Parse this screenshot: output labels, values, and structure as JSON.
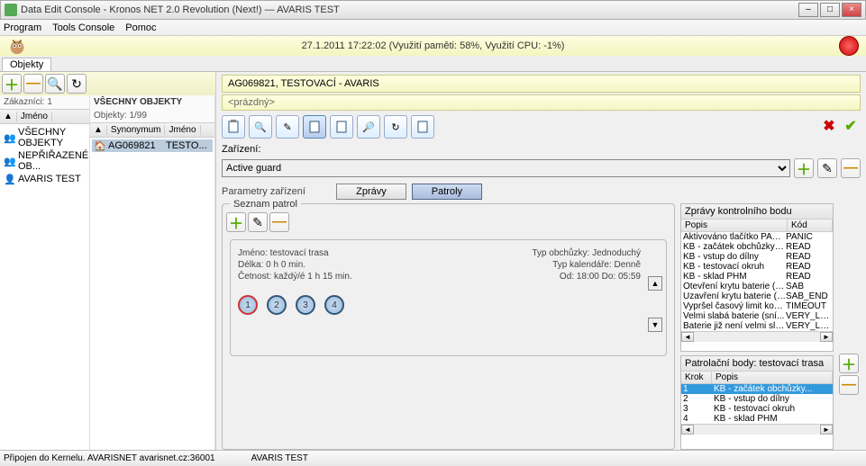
{
  "window": {
    "title": "Data Edit Console - Kronos NET 2.0 Revolution (Next!) — AVARIS TEST"
  },
  "menu": {
    "program": "Program",
    "tools": "Tools Console",
    "help": "Pomoc"
  },
  "topstatus": "27.1.2011 17:22:02 (Využití paměti: 58%, Využití CPU: -1%)",
  "tabs": {
    "objekty": "Objekty"
  },
  "left": {
    "all_objects": "VŠECHNY OBJEKTY",
    "customers": "Zákazníci: 1",
    "objects": "Objekty: 1/99",
    "col_name": "Jméno",
    "col_syn": "Synonymum",
    "col_name2": "Jméno",
    "tree": [
      {
        "label": "VŠECHNY OBJEKTY"
      },
      {
        "label": "NEPŘIŘAZENÉ OB..."
      },
      {
        "label": "AVARIS TEST"
      }
    ],
    "obj": {
      "syn": "AG069821",
      "name": "TESTO..."
    }
  },
  "header": {
    "title": "AG069821, TESTOVACÍ - AVARIS",
    "subtitle": "<prázdný>"
  },
  "device": {
    "label": "Zařízení:",
    "selected": "Active guard"
  },
  "paramtabs": {
    "params": "Parametry zařízení",
    "zpravy": "Zprávy",
    "patroly": "Patroly"
  },
  "patrolbox": {
    "title": "Seznam patrol",
    "info_name_label": "Jméno:",
    "info_name": "testovací trasa",
    "info_len_label": "Délka:",
    "info_len": "0 h 0 min.",
    "info_freq_label": "Četnost:",
    "info_freq": "každý/é 1 h 15 min.",
    "info_type_label": "Typ obchůzky:",
    "info_type": "Jednoduchý",
    "info_cal_label": "Typ kalendáře:",
    "info_cal": "Denně",
    "info_time_label": "Od:",
    "info_time": "18:00 Do: 05:59",
    "nodes": [
      "1",
      "2",
      "3",
      "4"
    ]
  },
  "msgpanel": {
    "title": "Zprávy kontrolního bodu",
    "col1": "Popis",
    "col2": "Kód",
    "rows": [
      {
        "popis": "Aktivováno tlačítko PANI...",
        "kod": "PANIC"
      },
      {
        "popis": "KB - začátek obchůzky (v...",
        "kod": "READ"
      },
      {
        "popis": "KB - vstup do dílny",
        "kod": "READ"
      },
      {
        "popis": "KB - testovací okruh",
        "kod": "READ"
      },
      {
        "popis": "KB - sklad PHM",
        "kod": "READ"
      },
      {
        "popis": "Otevření krytu baterie (a...",
        "kod": "SAB"
      },
      {
        "popis": "Uzavření krytu baterie (d...",
        "kod": "SAB_END"
      },
      {
        "popis": "Vypršel časový limit kont...",
        "kod": "TIMEOUT"
      },
      {
        "popis": "Velmi slabá baterie (sní...",
        "kod": "VERY_LOW"
      },
      {
        "popis": "Baterie již není velmi slabá",
        "kod": "VERY_LOW"
      }
    ]
  },
  "ptspanel": {
    "title": "Patrolační body: testovací trasa",
    "col1": "Krok",
    "col2": "Popis",
    "rows": [
      {
        "krok": "1",
        "popis": "KB - začátek obchůzky..."
      },
      {
        "krok": "2",
        "popis": "KB - vstup do dílny"
      },
      {
        "krok": "3",
        "popis": "KB - testovací okruh"
      },
      {
        "krok": "4",
        "popis": "KB - sklad PHM"
      }
    ]
  },
  "status": {
    "conn": "Připojen do Kernelu. AVARISNET avarisnet.cz:36001",
    "test": "AVARIS TEST"
  }
}
